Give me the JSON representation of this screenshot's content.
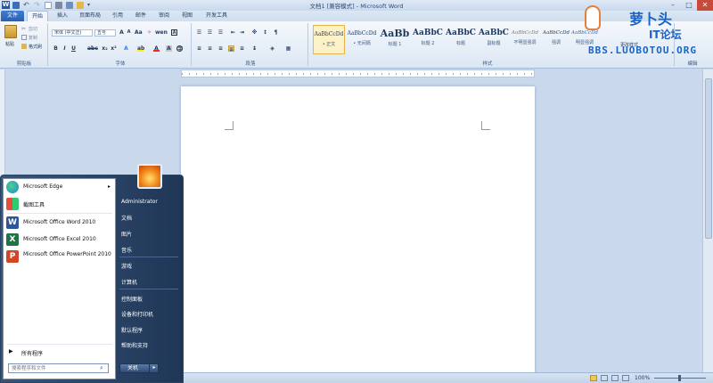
{
  "window": {
    "title": "文档1 [兼容模式] - Microsoft Word",
    "controls": [
      "–",
      "□",
      "✕"
    ]
  },
  "ribbon": {
    "tabs": [
      "文件",
      "开始",
      "插入",
      "页面布局",
      "引用",
      "邮件",
      "审阅",
      "视图",
      "开发工具"
    ],
    "clipboard": {
      "paste": "粘贴",
      "cut": "剪切",
      "copy": "复制",
      "format_painter": "格式刷",
      "label": "剪贴板"
    },
    "font": {
      "font_name": "宋体 (中文正)",
      "font_size": "五号",
      "label": "字体"
    },
    "paragraph": {
      "label": "段落"
    },
    "styles": {
      "label": "样式",
      "items": [
        {
          "preview": "AaBbCcDd",
          "name": "• 正文"
        },
        {
          "preview": "AaBbCcDd",
          "name": "• 无间隔"
        },
        {
          "preview": "AaBb",
          "name": "标题 1"
        },
        {
          "preview": "AaBbC",
          "name": "标题 2"
        },
        {
          "preview": "AaBbC",
          "name": "标题"
        },
        {
          "preview": "AaBbC",
          "name": "副标题"
        },
        {
          "preview": "AaBbCcDd",
          "name": "不明显强调"
        },
        {
          "preview": "AaBbCcDd",
          "name": "强调"
        },
        {
          "preview": "AaBbCcDd",
          "name": "明显强调"
        }
      ],
      "change_styles": "更改样式"
    },
    "editing": {
      "label": "编辑"
    }
  },
  "watermark": {
    "line1": "萝卜头",
    "line2": "IT论坛",
    "line3": "BBS.LUOBOTOU.ORG"
  },
  "statusbar": {
    "zoom": "100%"
  },
  "start_menu": {
    "programs": [
      {
        "label": "Microsoft Edge",
        "has_arrow": true,
        "icon": "edge-icon"
      },
      {
        "label": "截图工具",
        "icon": "snipping-tool-icon"
      },
      {
        "label": "Microsoft Office Word 2010",
        "icon": "word-icon"
      },
      {
        "label": "Microsoft Office Excel 2010",
        "icon": "excel-icon"
      },
      {
        "label": "Microsoft Office PowerPoint 2010",
        "icon": "powerpoint-icon"
      }
    ],
    "all_programs": "所有程序",
    "search_placeholder": "搜索程序和文件",
    "right_items": [
      "Administrator",
      "文档",
      "图片",
      "音乐",
      "游戏",
      "计算机",
      "控制面板",
      "设备和打印机",
      "默认程序",
      "帮助和支持"
    ],
    "shutdown": "关机"
  }
}
